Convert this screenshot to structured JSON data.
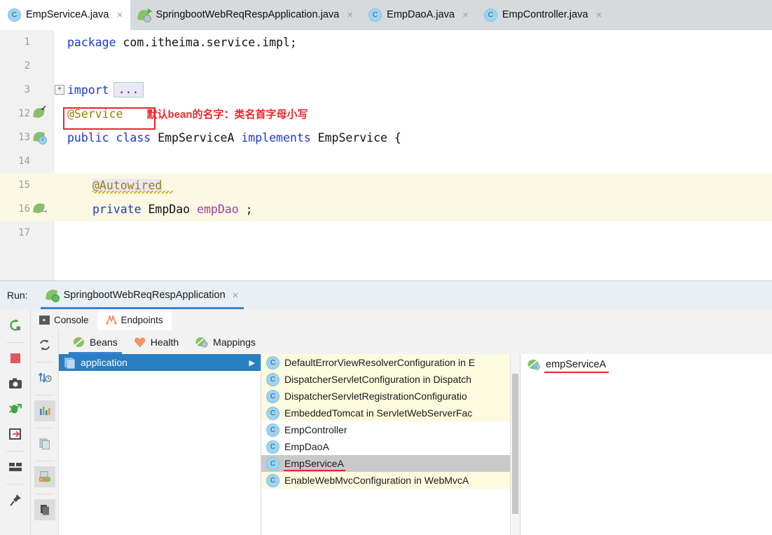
{
  "editor": {
    "tabs": [
      {
        "label": "EmpServiceA.java",
        "icon": "class-icon",
        "active": true,
        "closable": true
      },
      {
        "label": "SpringbootWebReqRespApplication.java",
        "icon": "spring-boot-run-icon",
        "active": false,
        "closable": true
      },
      {
        "label": "EmpDaoA.java",
        "icon": "class-icon",
        "active": false,
        "closable": true
      },
      {
        "label": "EmpController.java",
        "icon": "class-icon",
        "active": false,
        "closable": true
      }
    ],
    "close_glyph": "×",
    "lines": [
      {
        "number": "1",
        "gutter_icon": "none",
        "highlight": false
      },
      {
        "number": "2",
        "gutter_icon": "none",
        "highlight": false
      },
      {
        "number": "3",
        "gutter_icon": "none",
        "highlight": false,
        "fold": "+"
      },
      {
        "number": "12",
        "gutter_icon": "bean-check-icon",
        "highlight": false
      },
      {
        "number": "13",
        "gutter_icon": "bean-class-icon",
        "highlight": false
      },
      {
        "number": "14",
        "gutter_icon": "none",
        "highlight": false
      },
      {
        "number": "15",
        "gutter_icon": "none",
        "highlight": true
      },
      {
        "number": "16",
        "gutter_icon": "bean-autowire-icon",
        "highlight": true
      },
      {
        "number": "17",
        "gutter_icon": "none",
        "highlight": false
      }
    ],
    "code": {
      "l1_kw": "package",
      "l1_rest": " com.itheima.service.impl;",
      "l3_kw": "import",
      "l3_ellipsis": "...",
      "l12_annotation": "@Service",
      "l12_note": "默认bean的名字：类名首字母小写",
      "l13_kw1": "public class",
      "l13_name": " EmpServiceA ",
      "l13_kw2": "implements",
      "l13_rest": " EmpService {",
      "l15_annotation": "@Autowired",
      "l16_kw": "private",
      "l16_type": " EmpDao ",
      "l16_field": "empDao",
      "l16_semi": " ;"
    }
  },
  "run_window": {
    "label": "Run:",
    "tab": {
      "label": "SpringbootWebReqRespApplication",
      "icon": "spring-boot-running-icon",
      "active": true
    },
    "close_glyph": "×",
    "left_rail_icons": [
      "rerun-icon",
      "stop-icon",
      "camera-icon",
      "debug-attach-icon",
      "show-actual-icon",
      "layout-icon",
      "pin-icon"
    ],
    "sub_tabs": [
      {
        "label": "Console",
        "icon": "console-icon",
        "active": false
      },
      {
        "label": "Endpoints",
        "icon": "endpoints-icon",
        "active": true
      }
    ],
    "second_rail_icons": [
      "refresh-icon",
      "sort-icon",
      "chart-icon",
      "copy-icon",
      "export-icon",
      "duplicate-icon"
    ],
    "bean_tabs": [
      {
        "label": "Beans",
        "icon": "beans-icon",
        "active": true
      },
      {
        "label": "Health",
        "icon": "health-heart-icon",
        "active": false
      },
      {
        "label": "Mappings",
        "icon": "mappings-icon",
        "active": false
      }
    ],
    "app_tree": {
      "root_label": "application",
      "root_icon": "application-file-icon",
      "caret": "▶",
      "selected": true
    },
    "bean_list": [
      {
        "label": "DefaultErrorViewResolverConfiguration in E",
        "row_style": "yellow",
        "caret": true,
        "underline": false
      },
      {
        "label": "DispatcherServletConfiguration in Dispatch",
        "row_style": "yellow",
        "caret": true,
        "underline": false
      },
      {
        "label": "DispatcherServletRegistrationConfiguratio",
        "row_style": "yellow",
        "caret": true,
        "underline": false
      },
      {
        "label": "EmbeddedTomcat in ServletWebServerFac",
        "row_style": "yellow",
        "caret": true,
        "underline": false
      },
      {
        "label": "EmpController",
        "row_style": "white",
        "caret": false,
        "underline": false
      },
      {
        "label": "EmpDaoA",
        "row_style": "white",
        "caret": false,
        "underline": false
      },
      {
        "label": "EmpServiceA",
        "row_style": "selected",
        "caret": true,
        "underline": true
      },
      {
        "label": "EnableWebMvcConfiguration in WebMvcA",
        "row_style": "yellow",
        "caret": true,
        "underline": false
      }
    ],
    "bean_row_icon": "class-icon",
    "detail": {
      "label": "empServiceA",
      "icon": "spring-bean-icon",
      "underline": true
    }
  },
  "colors": {
    "accent_blue": "#3b7fd4",
    "selection_blue": "#2a7ec2",
    "annotation_red": "#e8262b",
    "keyword_blue": "#1a39d1",
    "annotation_gold": "#9b8100",
    "field_purple": "#a23ca2",
    "bean_green": "#86c06a",
    "row_yellow": "#fcfadf",
    "row_selected_gray": "#c9c9c9",
    "highlight_line": "#fdf8e3"
  }
}
